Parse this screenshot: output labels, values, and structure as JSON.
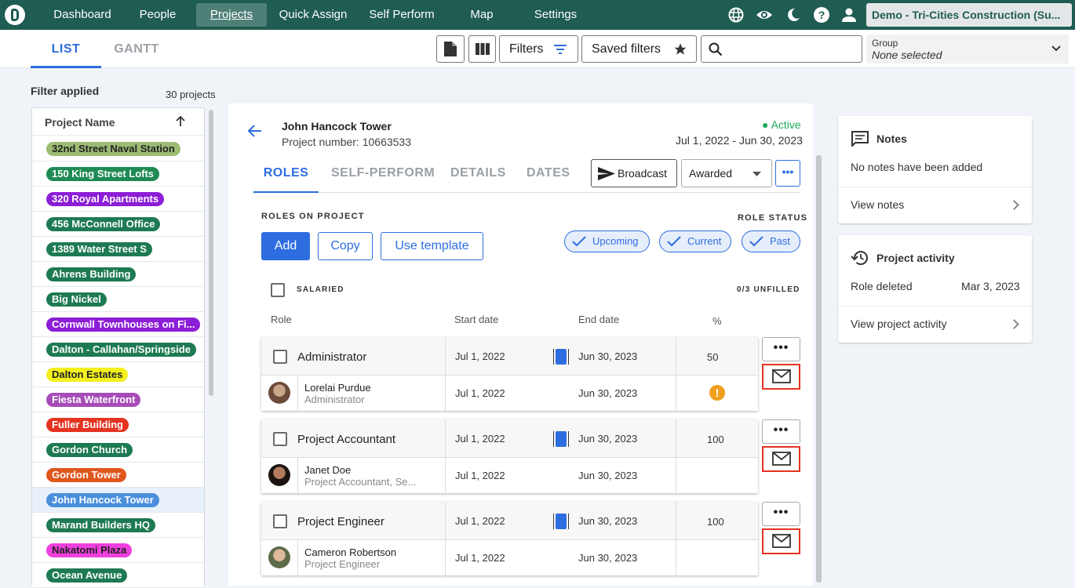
{
  "nav": {
    "items": [
      {
        "label": "Dashboard",
        "active": false
      },
      {
        "label": "People",
        "active": false
      },
      {
        "label": "Projects",
        "active": true
      },
      {
        "label": "Quick Assign",
        "active": false
      },
      {
        "label": "Self Perform",
        "active": false
      },
      {
        "label": "Map",
        "active": false
      },
      {
        "label": "Settings",
        "active": false
      }
    ],
    "icons": [
      "globe-icon",
      "eye-icon",
      "moon-icon",
      "help-icon",
      "user-icon"
    ],
    "org": "Demo - Tri-Cities Construction (Su..."
  },
  "view_tabs": {
    "list": "LIST",
    "gantt": "GANTT"
  },
  "toolbar": {
    "filters_label": "Filters",
    "saved_filters_label": "Saved filters",
    "search_placeholder": "",
    "group_label": "Group",
    "group_value": "None selected"
  },
  "sidebar": {
    "filter_applied": "Filter applied",
    "count": "30 projects",
    "column_header": "Project Name",
    "projects": [
      {
        "name": "32nd Street Naval Station",
        "color": "#9dbb74",
        "text": "#222"
      },
      {
        "name": "150 King Street Lofts",
        "color": "#1e8a54",
        "text": "#fff"
      },
      {
        "name": "320 Royal Apartments",
        "color": "#8c1ed6",
        "text": "#fff"
      },
      {
        "name": "456 McConnell Office",
        "color": "#1e7a52",
        "text": "#fff"
      },
      {
        "name": "1389 Water Street S",
        "color": "#1e7a52",
        "text": "#fff"
      },
      {
        "name": "Ahrens Building",
        "color": "#1e7a52",
        "text": "#fff"
      },
      {
        "name": "Big Nickel",
        "color": "#1e7a52",
        "text": "#fff"
      },
      {
        "name": "Cornwall Townhouses on Fi...",
        "color": "#8c1ed6",
        "text": "#fff"
      },
      {
        "name": "Dalton - Callahan/Springside",
        "color": "#1e7a52",
        "text": "#fff"
      },
      {
        "name": "Dalton Estates",
        "color": "#f4f01e",
        "text": "#222"
      },
      {
        "name": "Fiesta Waterfront",
        "color": "#a64cb8",
        "text": "#fff"
      },
      {
        "name": "Fuller Building",
        "color": "#e53321",
        "text": "#fff"
      },
      {
        "name": "Gordon Church",
        "color": "#1e7a52",
        "text": "#fff"
      },
      {
        "name": "Gordon Tower",
        "color": "#e0561c",
        "text": "#fff"
      },
      {
        "name": "John Hancock Tower",
        "color": "#4a8fdc",
        "text": "#fff",
        "selected": true
      },
      {
        "name": "Marand Builders HQ",
        "color": "#1e7a52",
        "text": "#fff"
      },
      {
        "name": "Nakatomi Plaza",
        "color": "#ef3fdd",
        "text": "#222"
      },
      {
        "name": "Ocean Avenue",
        "color": "#1e7a52",
        "text": "#fff"
      }
    ]
  },
  "project": {
    "title": "John Hancock Tower",
    "number": "Project number: 10663533",
    "status": "Active",
    "dates": "Jul 1, 2022 - Jun 30, 2023",
    "tabs": [
      "ROLES",
      "SELF-PERFORM",
      "DETAILS",
      "DATES"
    ],
    "broadcast_label": "Broadcast",
    "stage_value": "Awarded",
    "roles_caption": "ROLES ON PROJECT",
    "role_status_caption": "ROLE STATUS",
    "add_label": "Add",
    "copy_label": "Copy",
    "template_label": "Use template",
    "status_chips": [
      "Upcoming",
      "Current",
      "Past"
    ],
    "salaried_label": "SALARIED",
    "unfilled_label": "0/3 UNFILLED",
    "columns": {
      "role": "Role",
      "start": "Start date",
      "end": "End date",
      "pct": "%"
    },
    "roles": [
      {
        "name": "Administrator",
        "start": "Jul 1, 2022",
        "end": "Jun 30, 2023",
        "pct": "50",
        "person": "Lorelai Purdue",
        "person_role": "Administrator",
        "p_start": "Jul 1, 2022",
        "p_end": "Jun 30, 2023",
        "warning": true
      },
      {
        "name": "Project Accountant",
        "start": "Jul 1, 2022",
        "end": "Jun 30, 2023",
        "pct": "100",
        "person": "Janet Doe",
        "person_role": "Project Accountant, Se...",
        "p_start": "Jul 1, 2022",
        "p_end": "Jun 30, 2023",
        "warning": false
      },
      {
        "name": "Project Engineer",
        "start": "Jul 1, 2022",
        "end": "Jun 30, 2023",
        "pct": "100",
        "person": "Cameron Robertson",
        "person_role": "Project Engineer",
        "p_start": "Jul 1, 2022",
        "p_end": "Jun 30, 2023",
        "warning": false
      }
    ]
  },
  "notes": {
    "title": "Notes",
    "empty": "No notes have been added",
    "view": "View notes"
  },
  "activity": {
    "title": "Project activity",
    "event": "Role deleted",
    "event_date": "Mar 3, 2023",
    "view": "View project activity"
  }
}
